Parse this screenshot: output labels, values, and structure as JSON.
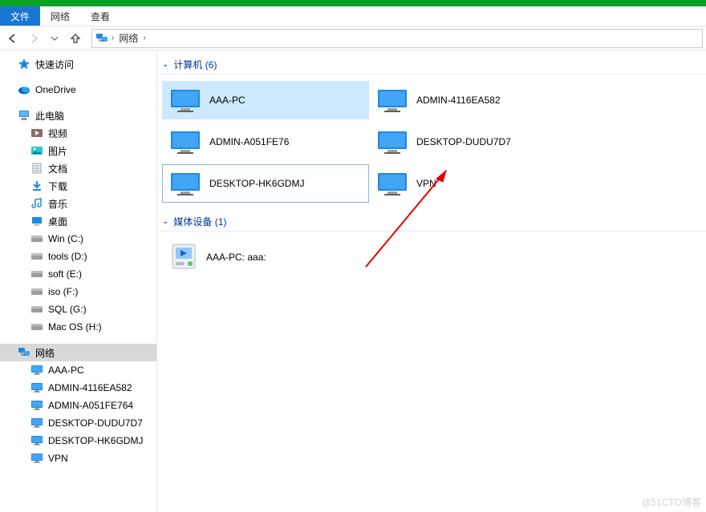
{
  "menu": {
    "file": "文件",
    "network": "网络",
    "view": "查看"
  },
  "breadcrumb": {
    "location": "网络"
  },
  "sidebar": {
    "quick_access": "快速访问",
    "onedrive": "OneDrive",
    "this_pc": "此电脑",
    "this_pc_children": [
      {
        "label": "视频",
        "icon": "video"
      },
      {
        "label": "图片",
        "icon": "pictures"
      },
      {
        "label": "文档",
        "icon": "docs"
      },
      {
        "label": "下载",
        "icon": "download"
      },
      {
        "label": "音乐",
        "icon": "music"
      },
      {
        "label": "桌面",
        "icon": "desktop"
      },
      {
        "label": "Win (C:)",
        "icon": "drive"
      },
      {
        "label": "tools (D:)",
        "icon": "drive"
      },
      {
        "label": "soft (E:)",
        "icon": "drive"
      },
      {
        "label": "iso (F:)",
        "icon": "drive"
      },
      {
        "label": "SQL (G:)",
        "icon": "drive"
      },
      {
        "label": "Mac OS (H:)",
        "icon": "drive"
      }
    ],
    "network": "网络",
    "network_children": [
      "AAA-PC",
      "ADMIN-4116EA582",
      "ADMIN-A051FE764",
      "DESKTOP-DUDU7D7",
      "DESKTOP-HK6GDMJ",
      "VPN"
    ]
  },
  "groups": {
    "computers": {
      "label": "计算机",
      "count": 6
    },
    "media": {
      "label": "媒体设备",
      "count": 1
    }
  },
  "computers": [
    {
      "name": "AAA-PC",
      "state": "sel"
    },
    {
      "name": "ADMIN-4116EA582",
      "state": ""
    },
    {
      "name": "ADMIN-A051FE76",
      "state": ""
    },
    {
      "name": "DESKTOP-DUDU7D7",
      "state": ""
    },
    {
      "name": "DESKTOP-HK6GDMJ",
      "state": "hl"
    },
    {
      "name": "VPN",
      "state": ""
    }
  ],
  "media": [
    {
      "name": "AAA-PC: aaa:"
    }
  ],
  "watermark": "@51CTO博客"
}
